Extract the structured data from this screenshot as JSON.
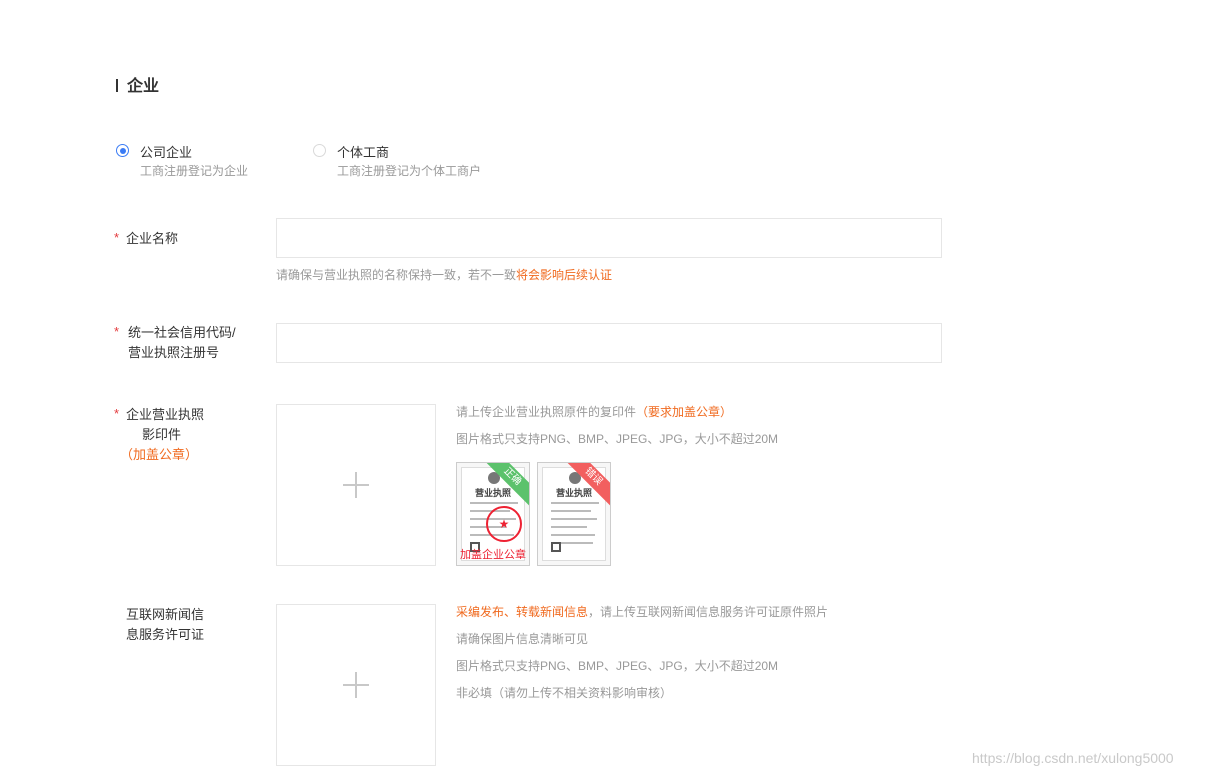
{
  "section": {
    "title": "企业"
  },
  "entity_type": {
    "options": [
      {
        "label": "公司企业",
        "desc": "工商注册登记为企业",
        "checked": true
      },
      {
        "label": "个体工商",
        "desc": "工商注册登记为个体工商户",
        "checked": false
      }
    ]
  },
  "company_name": {
    "required_mark": "*",
    "label": "企业名称",
    "value": "",
    "hint": "请确保与营业执照的名称保持一致，若不一致",
    "hint_warning": "将会影响后续认证"
  },
  "credit_code": {
    "required_mark": "*",
    "label_line1": "统一社会信用代码/",
    "label_line2": "营业执照注册号",
    "value": ""
  },
  "license_copy": {
    "required_mark": "*",
    "label_line1": "企业营业执照",
    "label_line2": "影印件",
    "label_note": "（加盖公章）",
    "upload_icon": "plus-icon",
    "info_line1": "请上传企业营业执照原件的复印件",
    "info_line1_note": "（要求加盖公章）",
    "info_line2": "图片格式只支持PNG、BMP、JPEG、JPG，大小不超过20M",
    "samples": {
      "correct": {
        "ribbon": "正确",
        "caption": "加盖企业公章",
        "doc_title": "营业执照",
        "seal_glyph": "★"
      },
      "wrong": {
        "ribbon": "错误",
        "doc_title": "营业执照"
      }
    }
  },
  "news_license": {
    "label_line1": "互联网新闻信",
    "label_line2": "息服务许可证",
    "upload_icon": "plus-icon",
    "info_line1_warning": "采编发布、转载新闻信息",
    "info_line1": "，请上传互联网新闻信息服务许可证原件照片",
    "info_line2": "请确保图片信息清晰可见",
    "info_line3": "图片格式只支持PNG、BMP、JPEG、JPG，大小不超过20M",
    "info_line4": "非必填（请勿上传不相关资料影响审核）"
  },
  "watermark": "https://blog.csdn.net/xulong5000",
  "colors": {
    "accent": "#3b7cf5",
    "warning": "#f06a1f",
    "required": "#e4393c",
    "ribbon_correct": "#5cc26c",
    "ribbon_wrong": "#f25f5f"
  }
}
